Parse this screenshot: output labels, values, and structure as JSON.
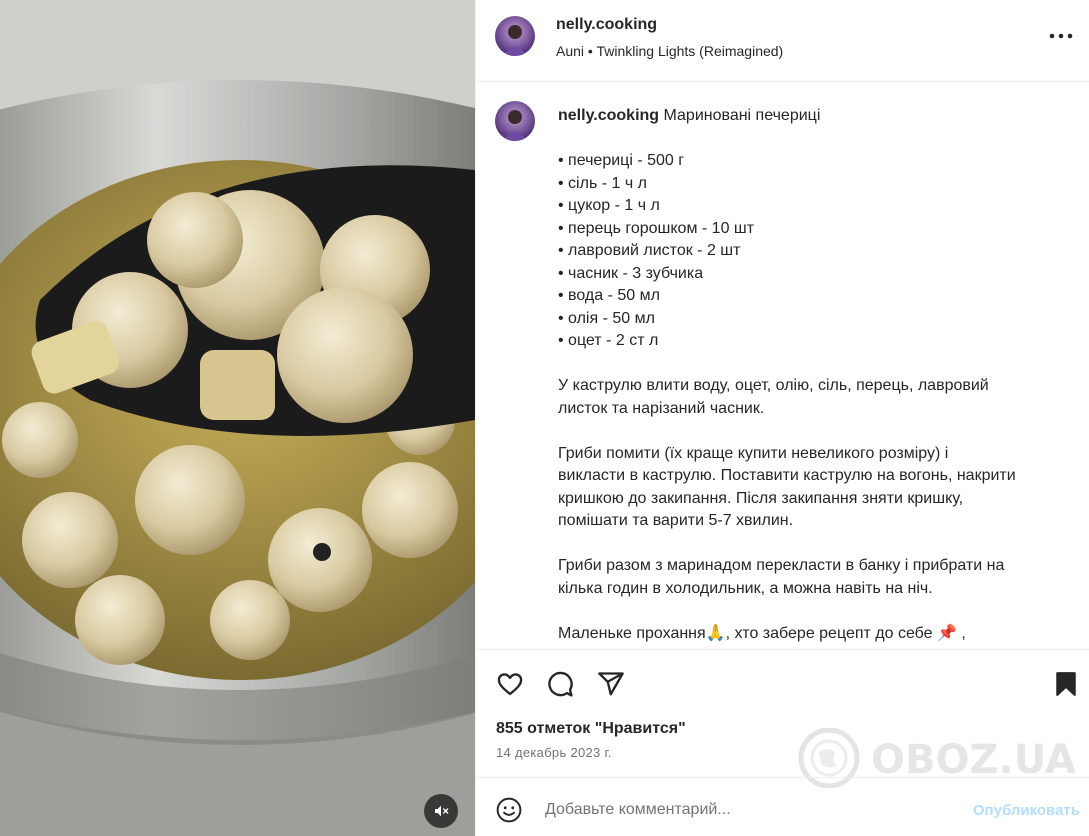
{
  "post": {
    "username": "nelly.cooking",
    "audio_artist": "Auni",
    "audio_separator": "•",
    "audio_title": "Twinkling Lights (Reimagined)",
    "more_icon": "more-horizontal-icon",
    "media_mute_icon": "speaker-muted-icon"
  },
  "caption": {
    "username": "nelly.cooking",
    "title": "Мариновані печериці",
    "ingredients": [
      "• печериці - 500 г",
      "• сіль - 1 ч л",
      "• цукор - 1 ч л",
      "• перець горошком - 10 шт",
      "• лавровий листок - 2 шт",
      "• часник - 3 зубчика",
      "• вода - 50 мл",
      "• олія - 50 мл",
      "• оцет - 2 ст л"
    ],
    "paragraphs": [
      [
        "У каструлю влити воду, оцет, олію, сіль, перець, лавровий",
        "листок та нарізаний часник."
      ],
      [
        "Гриби помити (їх краще купити невеликого розміру) і",
        "викласти в каструлю. Поставити каструлю на вогонь, накрити",
        "кришкою до закипання. Після закипання зняти кришку,",
        "помішати та варити 5-7 хвилин."
      ],
      [
        "Гриби разом з маринадом перекласти в банку і прибрати на",
        "кілька годин в холодильник, а можна навіть на ніч."
      ]
    ],
    "closing_text_a": "Маленьке прохання",
    "closing_emoji_a": "🙏",
    "closing_text_b": ", хто забере рецепт до себе",
    "closing_emoji_b": "📌",
    "closing_text_c": " ,"
  },
  "actions": {
    "like_icon": "heart-icon",
    "comment_icon": "comment-icon",
    "share_icon": "share-icon",
    "save_icon": "bookmark-icon"
  },
  "likes_text": "855 отметок \"Нравится\"",
  "date_text": "14 декабрь 2023 г.",
  "watermark": {
    "text": "OBOZ.UA"
  },
  "comment": {
    "emoji_icon": "smiley-icon",
    "placeholder": "Добавьте комментарий...",
    "publish_label": "Опубликовать",
    "publish_color": "#b2dffc"
  },
  "colors": {
    "text": "#262626",
    "secondary": "#737373",
    "divider": "#efefef"
  }
}
